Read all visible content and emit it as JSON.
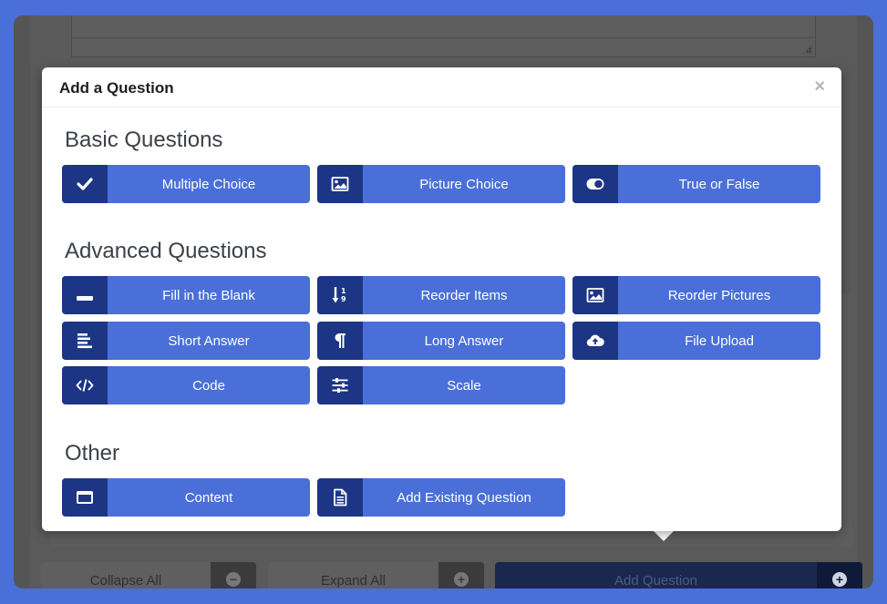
{
  "modal": {
    "title": "Add a Question",
    "close_label": "×",
    "sections": [
      {
        "title": "Basic Questions",
        "items": [
          {
            "label": "Multiple Choice",
            "icon": "check-icon"
          },
          {
            "label": "Picture Choice",
            "icon": "image-icon"
          },
          {
            "label": "True or False",
            "icon": "toggle-icon"
          }
        ]
      },
      {
        "title": "Advanced Questions",
        "items": [
          {
            "label": "Fill in the Blank",
            "icon": "minus-icon"
          },
          {
            "label": "Reorder Items",
            "icon": "sort-numeric-icon"
          },
          {
            "label": "Reorder Pictures",
            "icon": "image-icon"
          },
          {
            "label": "Short Answer",
            "icon": "align-left-icon"
          },
          {
            "label": "Long Answer",
            "icon": "paragraph-icon"
          },
          {
            "label": "File Upload",
            "icon": "cloud-upload-icon"
          },
          {
            "label": "Code",
            "icon": "code-icon"
          },
          {
            "label": "Scale",
            "icon": "sliders-icon"
          }
        ]
      },
      {
        "title": "Other",
        "items": [
          {
            "label": "Content",
            "icon": "window-icon"
          },
          {
            "label": "Add Existing Question",
            "icon": "file-text-icon"
          }
        ]
      }
    ]
  },
  "bottom_bar": {
    "collapse_all": "Collapse All",
    "expand_all": "Expand All",
    "add_question": "Add Question",
    "minus_glyph": "−",
    "plus_glyph": "+"
  },
  "colors": {
    "accent": "#4a6fd8",
    "icon_bg": "#1c3685",
    "page_bg": "#4a6fd8"
  }
}
